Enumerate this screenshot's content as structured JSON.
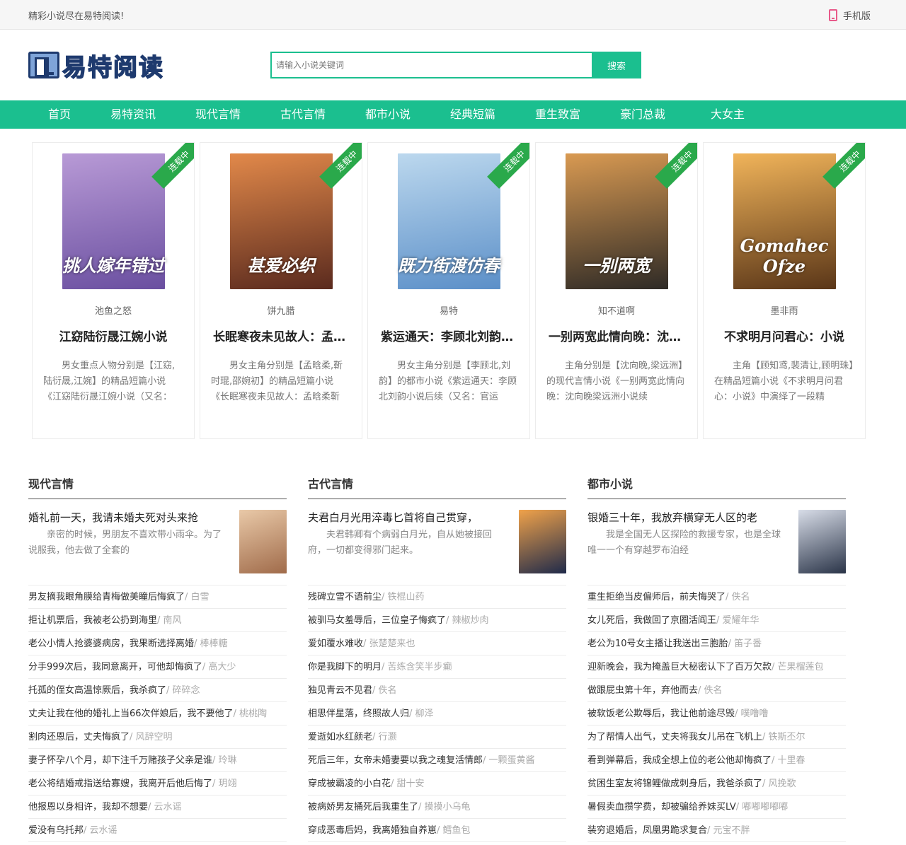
{
  "topbar": {
    "slogan": "精彩小说尽在易特阅读!",
    "mobile": "手机版"
  },
  "header": {
    "logo": "易特阅读",
    "search_placeholder": "请输入小说关键词",
    "search_button": "搜索"
  },
  "nav": [
    "首页",
    "易特资讯",
    "现代言情",
    "古代言情",
    "都市小说",
    "经典短篇",
    "重生致富",
    "豪门总裁",
    "大女主"
  ],
  "featured": [
    {
      "badge": "连载中",
      "cover_text": "挑人嫁年错过",
      "author": "池鱼之怒",
      "title": "江窈陆衍晟江婉小说",
      "desc": "男女重点人物分别是【江窈,陆衍晟,江婉】的精品短篇小说《江窈陆衍晟江婉小说（又名：",
      "colors": [
        "#b89ad6",
        "#6a4fa0"
      ]
    },
    {
      "badge": "连载中",
      "cover_text": "甚爱必织",
      "author": "饼九腊",
      "title": "长眠寒夜未见故人：孟晗柔靳时琨邵婉初",
      "desc": "男女主角分别是【孟晗柔,靳时琨,邵婉初】的精品短篇小说《长眠寒夜未见故人：孟晗柔靳",
      "colors": [
        "#e2894a",
        "#5a2a1e"
      ]
    },
    {
      "badge": "连载中",
      "cover_text": "既力街渡仿春",
      "author": "易特",
      "title": "紫运通天：李顾北刘韵小说后续",
      "desc": "男女主角分别是【李顾北,刘韵】的都市小说《紫运通天：李顾北刘韵小说后续（又名：官运",
      "colors": [
        "#bcd8ee",
        "#5b8fc8"
      ]
    },
    {
      "badge": "连载中",
      "cover_text": "一别两宽",
      "author": "知不道啊",
      "title": "一别两宽此情向晚：沈向晚梁远洲小说续",
      "desc": "主角分别是【沈向晚,梁远洲】的现代言情小说《一别两宽此情向晚：沈向晚梁远洲小说续",
      "colors": [
        "#d99a52",
        "#2e2a26"
      ]
    },
    {
      "badge": "连载中",
      "cover_text": "Gomahec Ofze",
      "author": "墨非雨",
      "title": "不求明月问君心：小说",
      "desc": "主角【顾知鸢,裴清让,顾明珠】在精品短篇小说《不求明月问君心：小说》中演绎了一段精",
      "colors": [
        "#f1b45a",
        "#5a3618"
      ]
    }
  ],
  "columns": [
    {
      "title": "现代言情",
      "top": {
        "title": "婚礼前一天，我请未婚夫死对头来抢",
        "desc": "亲密的时候，男朋友不喜欢带小雨伞。为了说服我，他去做了全套的",
        "colors": [
          "#e9c9a8",
          "#a06b4a"
        ]
      },
      "items": [
        {
          "t": "男友摘我眼角膜给青梅做美瞳后悔疯了",
          "a": "白雪"
        },
        {
          "t": "拒让机票后，我被老公扔到海里",
          "a": "南风"
        },
        {
          "t": "老公小情人抢婆婆病房，我果断选择离婚",
          "a": "棒棒糖"
        },
        {
          "t": "分手999次后，我同意离开，可他却悔疯了",
          "a": "高大少"
        },
        {
          "t": "托孤的侄女高温惊厥后，我杀疯了",
          "a": "碎碎念"
        },
        {
          "t": "丈夫让我在他的婚礼上当66次伴娘后，我不要他了",
          "a": "桃桃陶"
        },
        {
          "t": "割肉还恩后，丈夫悔疯了",
          "a": "风辞空明"
        },
        {
          "t": "妻子怀孕八个月，却下注千万赌孩子父亲是谁",
          "a": "玲琳"
        },
        {
          "t": "老公将结婚戒指送给寡嫂，我离开后他后悔了",
          "a": "玥翊"
        },
        {
          "t": "他报恩以身相许，我却不想要",
          "a": "云水谣"
        },
        {
          "t": "爱没有乌托邦",
          "a": "云水谣"
        }
      ]
    },
    {
      "title": "古代言情",
      "top": {
        "title": "夫君白月光用淬毒匕首将自己贯穿，",
        "desc": "夫君韩卿有个病弱白月光，自从她被接回府，一切都变得邪门起来。",
        "colors": [
          "#f0a24a",
          "#1f2a4a"
        ]
      },
      "items": [
        {
          "t": "残碑立雪不语前尘",
          "a": "铁棍山药"
        },
        {
          "t": "被驯马女羞辱后，三位皇子悔疯了",
          "a": "辣椒炒肉"
        },
        {
          "t": "爱如覆水难收",
          "a": "张楚楚来也"
        },
        {
          "t": "你是我脚下的明月",
          "a": "苦练含笑半步癫"
        },
        {
          "t": "独见青云不见君",
          "a": "佚名"
        },
        {
          "t": "相思伴星落，终照故人归",
          "a": "柳泽"
        },
        {
          "t": "爱逝如水红颜老",
          "a": "行灏"
        },
        {
          "t": "死后三年，女帝未婚妻要以我之魂复活情郎",
          "a": "一颗蛋黄酱"
        },
        {
          "t": "穿成被霸凌的小白花",
          "a": "甜十安"
        },
        {
          "t": "被病娇男友捅死后我重生了",
          "a": "摸摸小乌龟"
        },
        {
          "t": "穿成恶毒后妈，我离婚独自养崽",
          "a": "鳕鱼包"
        }
      ]
    },
    {
      "title": "都市小说",
      "top": {
        "title": "银婚三十年，我放弃横穿无人区的老",
        "desc": "我是全国无人区探险的救援专家，也是全球唯一一个有穿越罗布泊经",
        "colors": [
          "#d8dde8",
          "#2a3448"
        ]
      },
      "items": [
        {
          "t": "重生拒绝当皮偏师后，前夫悔哭了",
          "a": "佚名"
        },
        {
          "t": "女儿死后，我做回了京圈活阎王",
          "a": "爱耀年华"
        },
        {
          "t": "老公为10号女主播让我送出三胞胎",
          "a": "笛子番"
        },
        {
          "t": "迎新晚会，我为掩盖巨大秘密认下了百万欠款",
          "a": "芒果榴莲包"
        },
        {
          "t": "做跟屁虫第十年，弃他而去",
          "a": "佚名"
        },
        {
          "t": "被软饭老公欺辱后，我让他前途尽毁",
          "a": "噗噜噜"
        },
        {
          "t": "为了帮情人出气，丈夫将我女儿吊在飞机上",
          "a": "铁斯丕尔"
        },
        {
          "t": "看到弹幕后，我成全想上位的老公他却悔疯了",
          "a": "十里春"
        },
        {
          "t": "贫困生室友将锦鲤做成刺身后，我爸杀疯了",
          "a": "风挽歌"
        },
        {
          "t": "暑假卖血攒学费，却被骗给养妹买LV",
          "a": "嘟嘟嘟嘟嘟"
        },
        {
          "t": "装穷退婚后，凤凰男跪求复合",
          "a": "元宝不胖"
        }
      ]
    }
  ]
}
